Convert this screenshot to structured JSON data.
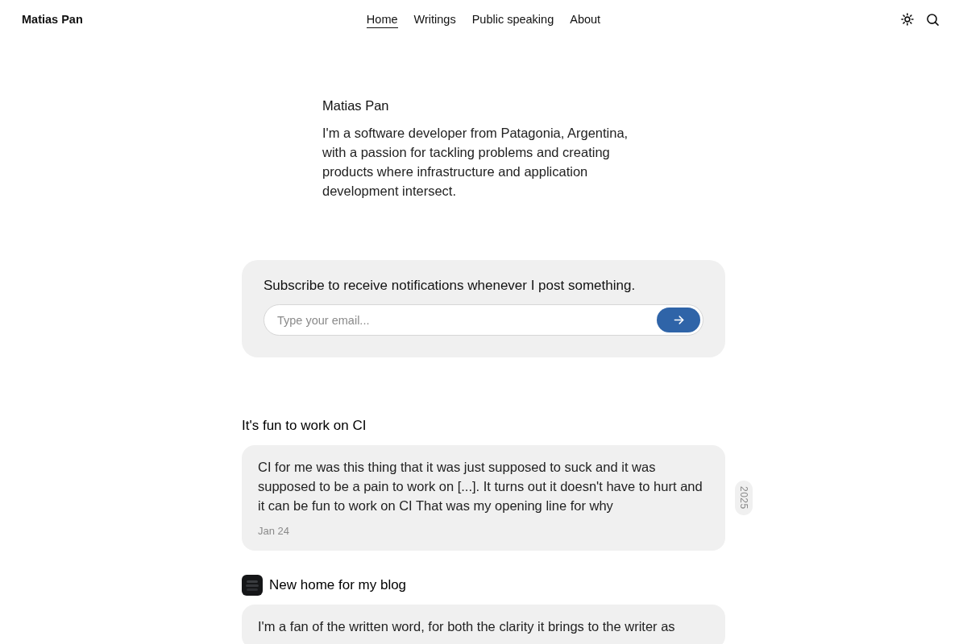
{
  "header": {
    "site_name": "Matias Pan",
    "nav": [
      {
        "label": "Home",
        "selected": true
      },
      {
        "label": "Writings",
        "selected": false
      },
      {
        "label": "Public speaking",
        "selected": false
      },
      {
        "label": "About",
        "selected": false
      }
    ]
  },
  "intro": {
    "name": "Matias Pan",
    "bio": "I'm a software developer from Patagonia, Argentina, with a passion for tackling problems and creating products where infrastructure and application development intersect."
  },
  "subscribe": {
    "heading": "Subscribe to receive notifications whenever I post something.",
    "placeholder": "Type your email..."
  },
  "posts": [
    {
      "title": "It's fun to work on CI",
      "thumbnail": false,
      "excerpt": "CI for me was this thing that it was just supposed to suck and it was supposed to be a pain to work on [...]. It turns out it doesn't have to hurt and it can be fun to work on CI That was my opening line for why",
      "date": "Jan 24",
      "year": "2025"
    },
    {
      "title": "New home for my blog",
      "thumbnail": true,
      "excerpt": "I'm a fan of the written word, for both the clarity it brings to the writer as"
    }
  ]
}
